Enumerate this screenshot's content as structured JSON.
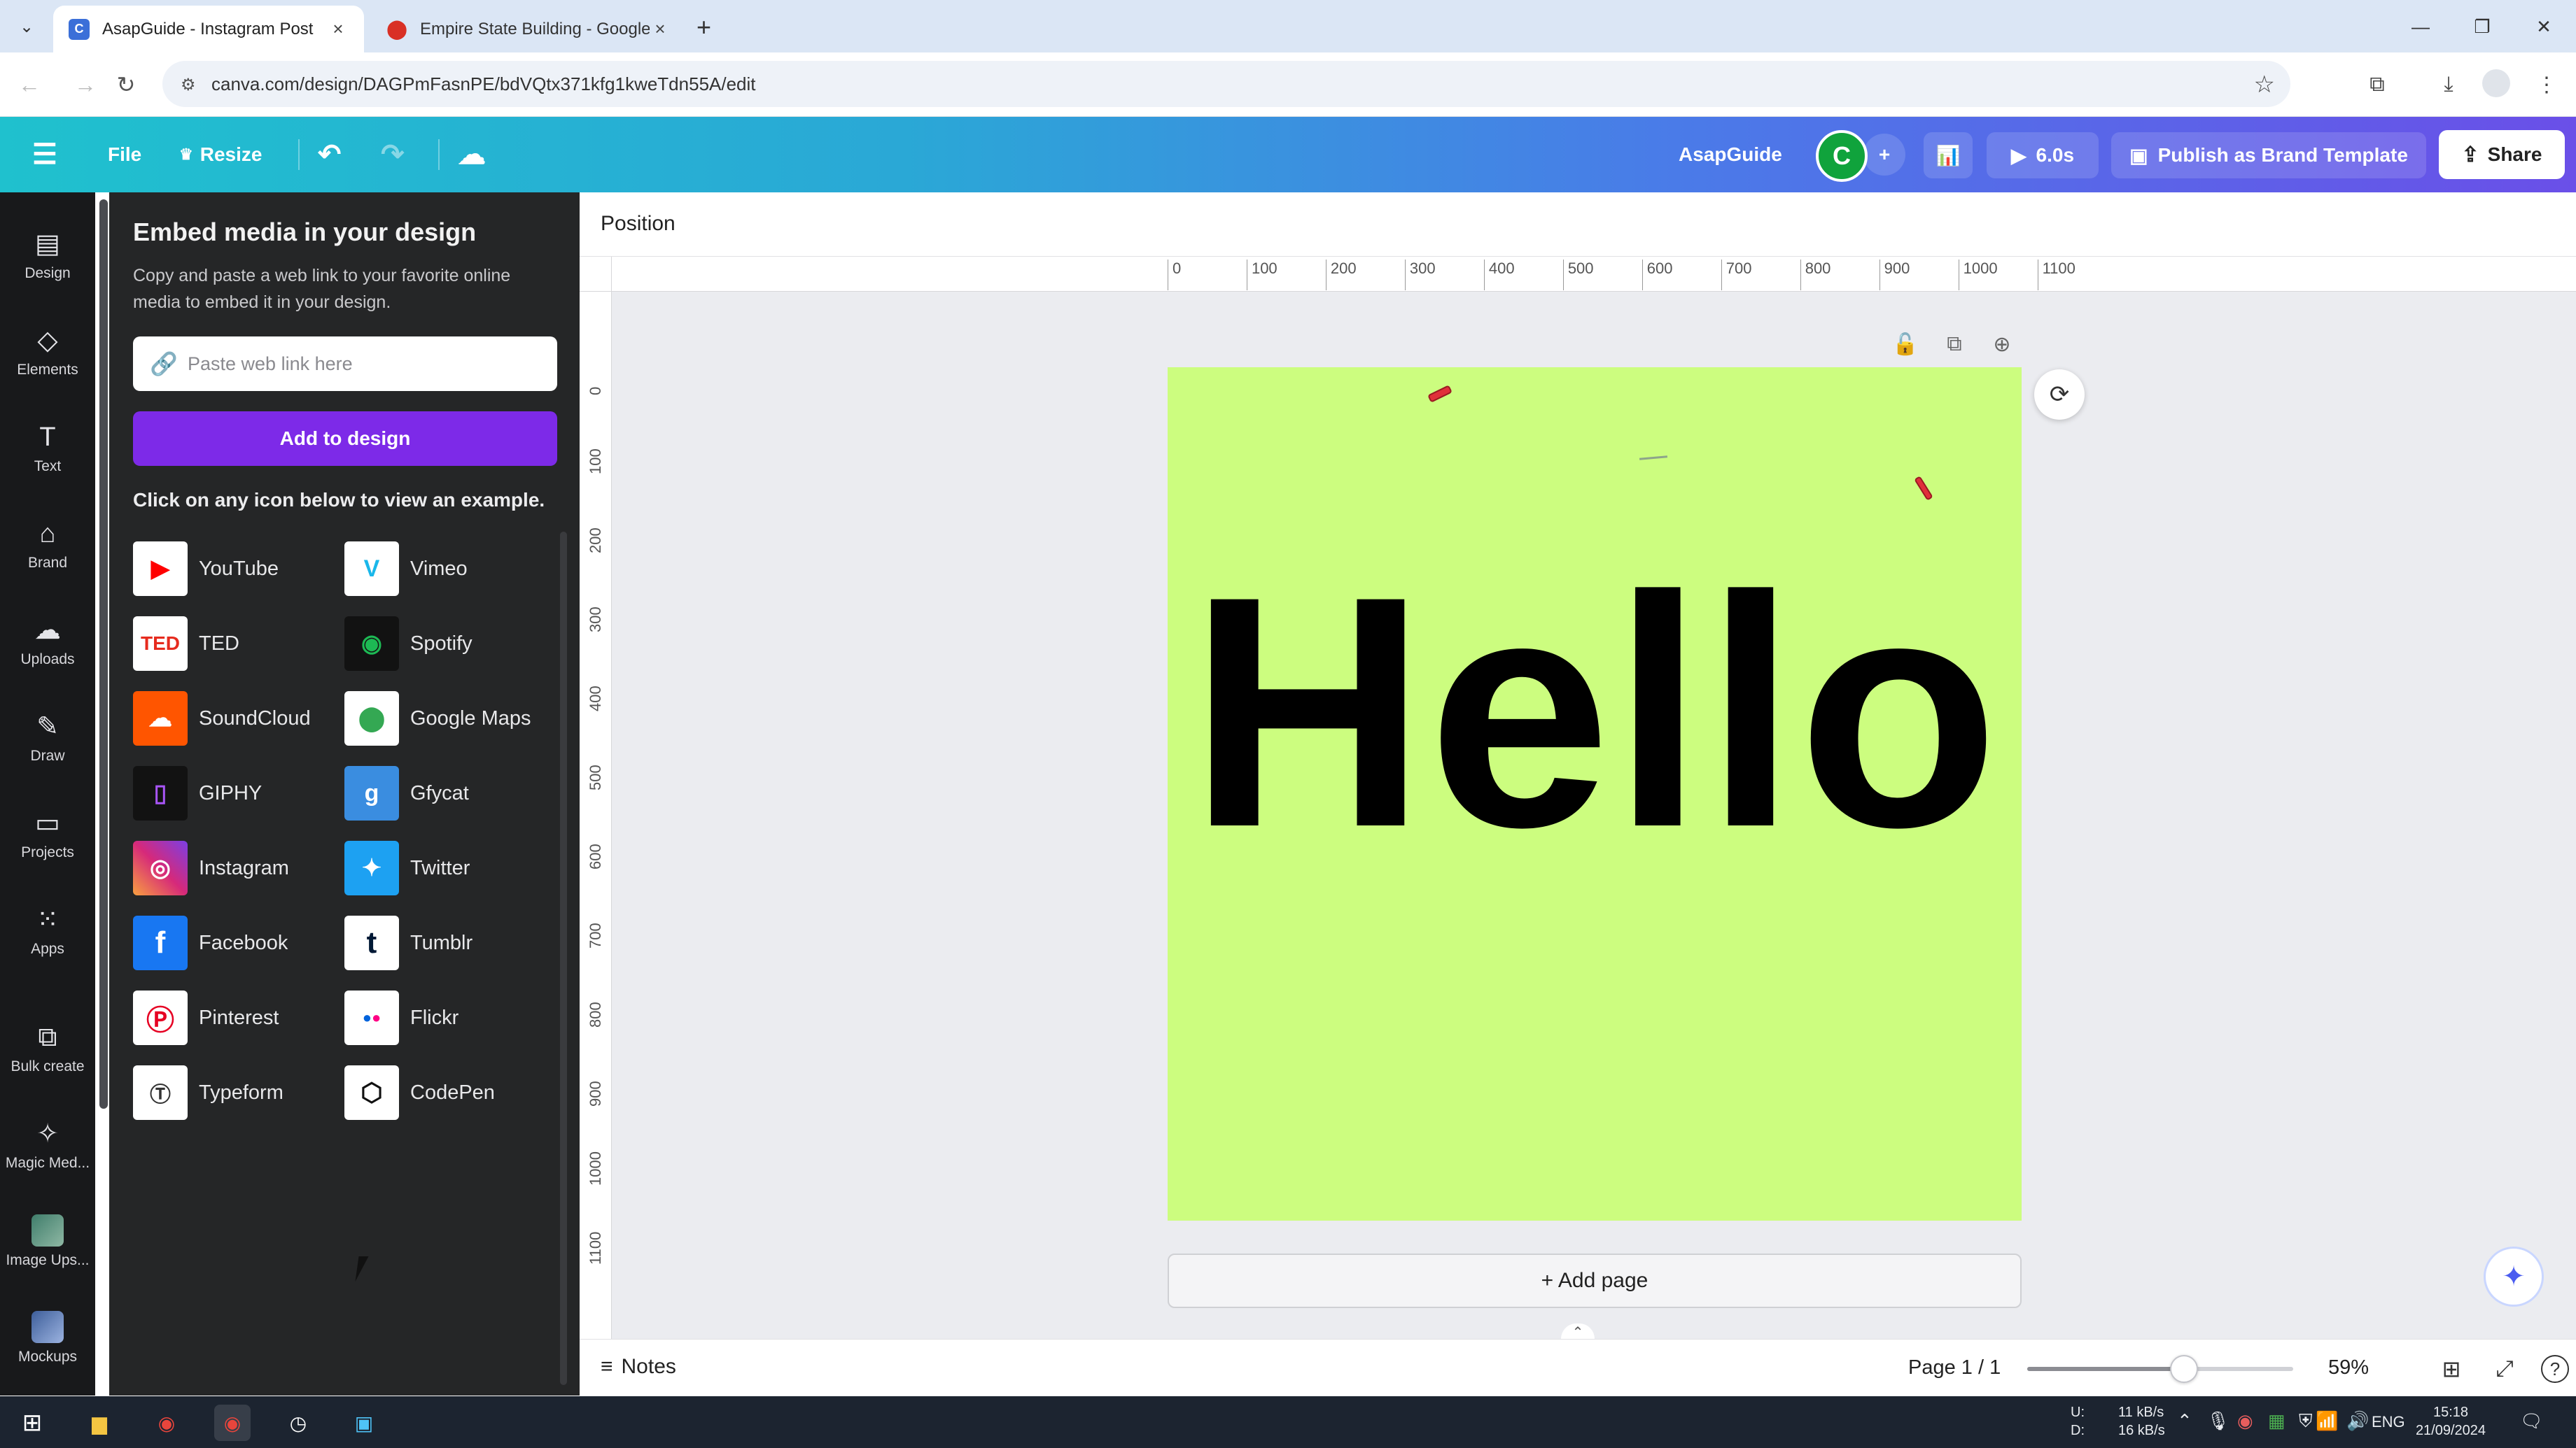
{
  "browser": {
    "tabs": [
      {
        "title": "AsapGuide - Instagram Post",
        "active": true,
        "favicon": "canva-icon"
      },
      {
        "title": "Empire State Building - Google",
        "active": false,
        "favicon": "maps-pin-icon"
      }
    ],
    "url": "canva.com/design/DAGPmFasnPE/bdVQtx371kfg1kweTdn55A/edit"
  },
  "canva_toolbar": {
    "file_label": "File",
    "resize_label": "Resize",
    "team_name": "AsapGuide",
    "avatar_letter": "C",
    "play_label": "6.0s",
    "publish_label": "Publish as Brand Template",
    "share_label": "Share"
  },
  "rail": {
    "items": [
      {
        "label": "Design",
        "icon": "layout-icon"
      },
      {
        "label": "Elements",
        "icon": "shapes-icon"
      },
      {
        "label": "Text",
        "icon": "text-icon"
      },
      {
        "label": "Brand",
        "icon": "brand-icon"
      },
      {
        "label": "Uploads",
        "icon": "cloud-upload-icon"
      },
      {
        "label": "Draw",
        "icon": "pen-icon"
      },
      {
        "label": "Projects",
        "icon": "folder-icon"
      },
      {
        "label": "Apps",
        "icon": "apps-grid-icon"
      },
      {
        "label": "Bulk create",
        "icon": "bulk-create-icon"
      },
      {
        "label": "Magic Med...",
        "icon": "magic-media-icon"
      },
      {
        "label": "Image Ups...",
        "icon": "image-upscaler-icon"
      },
      {
        "label": "Mockups",
        "icon": "mockups-icon"
      }
    ]
  },
  "panel": {
    "heading": "Embed media in your design",
    "description": "Copy and paste a web link to your favorite online media to embed it in your design.",
    "link_placeholder": "Paste web link here",
    "add_button": "Add to design",
    "examples_heading": "Click on any icon below to view an example.",
    "services": [
      {
        "name": "YouTube",
        "color": "#ff0000",
        "glyph": "▶"
      },
      {
        "name": "Vimeo",
        "color": "#ffffff",
        "glyph": "V"
      },
      {
        "name": "TED",
        "color": "#ffffff",
        "glyph": "TED"
      },
      {
        "name": "Spotify",
        "color": "#121212",
        "glyph": "≋"
      },
      {
        "name": "SoundCloud",
        "color": "#ff5500",
        "glyph": "☁"
      },
      {
        "name": "Google Maps",
        "color": "#ffffff",
        "glyph": "📍"
      },
      {
        "name": "GIPHY",
        "color": "#121212",
        "glyph": "▯"
      },
      {
        "name": "Gfycat",
        "color": "#3a8de0",
        "glyph": "g"
      },
      {
        "name": "Instagram",
        "color": "#d6297a",
        "glyph": "◎"
      },
      {
        "name": "Twitter",
        "color": "#1da1f2",
        "glyph": "🐦"
      },
      {
        "name": "Facebook",
        "color": "#1877f2",
        "glyph": "f"
      },
      {
        "name": "Tumblr",
        "color": "#001935",
        "glyph": "t"
      },
      {
        "name": "Pinterest",
        "color": "#ffffff",
        "glyph": "P"
      },
      {
        "name": "Flickr",
        "color": "#ffffff",
        "glyph": "●●"
      },
      {
        "name": "Typeform",
        "color": "#ffffff",
        "glyph": "T"
      },
      {
        "name": "CodePen",
        "color": "#ffffff",
        "glyph": "⬡"
      }
    ]
  },
  "editor": {
    "position_label": "Position",
    "ruler_top": [
      "0",
      "100",
      "200",
      "300",
      "400",
      "500",
      "600",
      "700",
      "800",
      "900",
      "1000",
      "1100"
    ],
    "ruler_left": [
      "0",
      "100",
      "200",
      "300",
      "400",
      "500",
      "600",
      "700",
      "800",
      "900",
      "1000",
      "1100"
    ],
    "canvas_text": "Hello",
    "canvas_bg": "#ccfd7f",
    "add_page_label": "+ Add page"
  },
  "footer": {
    "notes_label": "Notes",
    "page_count": "Page 1 / 1",
    "zoom_fraction": 0.59,
    "zoom_label": "59%"
  },
  "taskbar": {
    "net_up": "11 kB/s",
    "net_down": "16 kB/s",
    "net_up_label": "U:",
    "net_down_label": "D:",
    "lang": "ENG",
    "time": "15:18",
    "date": "21/09/2024"
  }
}
